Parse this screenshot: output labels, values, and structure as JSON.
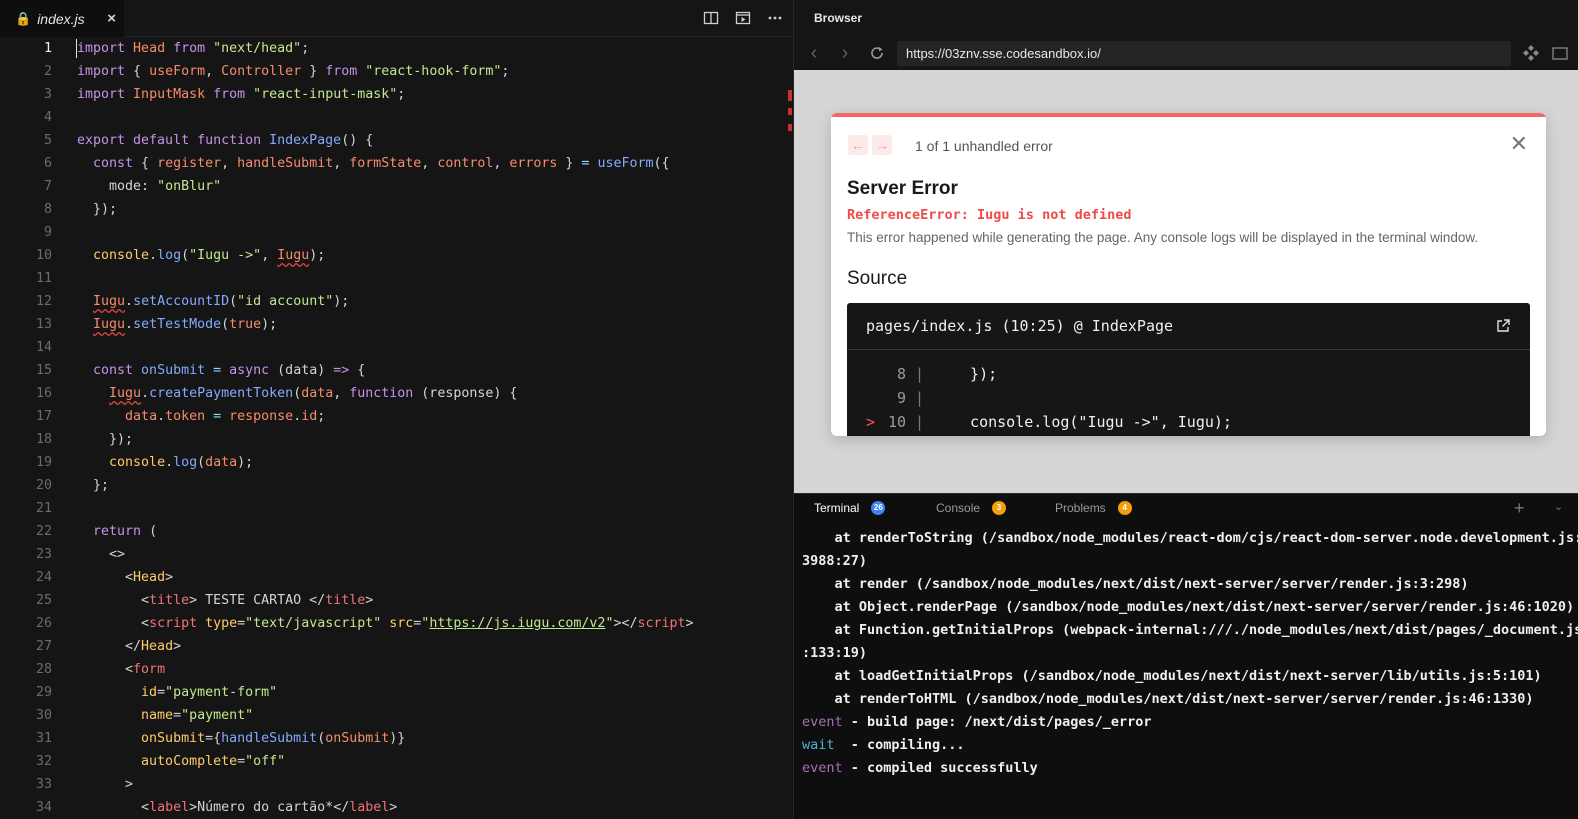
{
  "editor": {
    "tab": {
      "filename": "index.js",
      "close_glyph": "×"
    },
    "cursor_line": 1,
    "lines": [
      {
        "n": "1",
        "t": [
          [
            "kw",
            "import"
          ],
          [
            "var",
            " Head "
          ],
          [
            "kw",
            "from"
          ],
          [
            "str",
            " \"next/head\""
          ],
          [
            "dim",
            ";"
          ]
        ]
      },
      {
        "n": "2",
        "t": [
          [
            "kw",
            "import"
          ],
          [
            "dim",
            " { "
          ],
          [
            "var",
            "useForm"
          ],
          [
            "dim",
            ", "
          ],
          [
            "var",
            "Controller"
          ],
          [
            "dim",
            " } "
          ],
          [
            "kw",
            "from"
          ],
          [
            "str",
            " \"react-hook-form\""
          ],
          [
            "dim",
            ";"
          ]
        ]
      },
      {
        "n": "3",
        "t": [
          [
            "kw",
            "import"
          ],
          [
            "var",
            " InputMask "
          ],
          [
            "kw",
            "from"
          ],
          [
            "str",
            " \"react-input-mask\""
          ],
          [
            "dim",
            ";"
          ]
        ]
      },
      {
        "n": "4",
        "t": []
      },
      {
        "n": "5",
        "t": [
          [
            "kw",
            "export default function"
          ],
          [
            "fn",
            " IndexPage"
          ],
          [
            "dim",
            "() {"
          ]
        ]
      },
      {
        "n": "6",
        "t": [
          [
            "dim",
            "  "
          ],
          [
            "kw",
            "const"
          ],
          [
            "dim",
            " { "
          ],
          [
            "var",
            "register"
          ],
          [
            "dim",
            ", "
          ],
          [
            "var",
            "handleSubmit"
          ],
          [
            "dim",
            ", "
          ],
          [
            "var",
            "formState"
          ],
          [
            "dim",
            ", "
          ],
          [
            "var",
            "control"
          ],
          [
            "dim",
            ", "
          ],
          [
            "var",
            "errors"
          ],
          [
            "dim",
            " } "
          ],
          [
            "op",
            "="
          ],
          [
            "fn",
            " useForm"
          ],
          [
            "dim",
            "({"
          ]
        ]
      },
      {
        "n": "7",
        "t": [
          [
            "dim",
            "    mode: "
          ],
          [
            "str",
            "\"onBlur\""
          ]
        ]
      },
      {
        "n": "8",
        "t": [
          [
            "dim",
            "  });"
          ]
        ]
      },
      {
        "n": "9",
        "t": []
      },
      {
        "n": "10",
        "t": [
          [
            "dim",
            "  "
          ],
          [
            "yl",
            "console"
          ],
          [
            "dim",
            "."
          ],
          [
            "fn",
            "log"
          ],
          [
            "dim",
            "("
          ],
          [
            "str",
            "\"Iugu ->\""
          ],
          [
            "dim",
            ", "
          ],
          [
            "var err",
            "Iugu"
          ],
          [
            "dim",
            ");"
          ]
        ]
      },
      {
        "n": "11",
        "t": []
      },
      {
        "n": "12",
        "t": [
          [
            "dim",
            "  "
          ],
          [
            "var err",
            "Iugu"
          ],
          [
            "dim",
            "."
          ],
          [
            "fn",
            "setAccountID"
          ],
          [
            "dim",
            "("
          ],
          [
            "str",
            "\"id account\""
          ],
          [
            "dim",
            ");"
          ]
        ]
      },
      {
        "n": "13",
        "t": [
          [
            "dim",
            "  "
          ],
          [
            "var err",
            "Iugu"
          ],
          [
            "dim",
            "."
          ],
          [
            "fn",
            "setTestMode"
          ],
          [
            "dim",
            "("
          ],
          [
            "var",
            "true"
          ],
          [
            "dim",
            ");"
          ]
        ]
      },
      {
        "n": "14",
        "t": []
      },
      {
        "n": "15",
        "t": [
          [
            "dim",
            "  "
          ],
          [
            "kw",
            "const"
          ],
          [
            "fn",
            " onSubmit"
          ],
          [
            "op",
            " ="
          ],
          [
            "kw",
            " async"
          ],
          [
            "dim",
            " (data) "
          ],
          [
            "kw",
            "=>"
          ],
          [
            "dim",
            " {"
          ]
        ]
      },
      {
        "n": "16",
        "t": [
          [
            "dim",
            "    "
          ],
          [
            "var err",
            "Iugu"
          ],
          [
            "dim",
            "."
          ],
          [
            "fn",
            "createPaymentToken"
          ],
          [
            "dim",
            "("
          ],
          [
            "var",
            "data"
          ],
          [
            "dim",
            ", "
          ],
          [
            "kw",
            "function"
          ],
          [
            "dim",
            " (response) {"
          ]
        ]
      },
      {
        "n": "17",
        "t": [
          [
            "dim",
            "      "
          ],
          [
            "var",
            "data"
          ],
          [
            "dim",
            "."
          ],
          [
            "var",
            "token"
          ],
          [
            "op",
            " ="
          ],
          [
            "var",
            " response"
          ],
          [
            "dim",
            "."
          ],
          [
            "var",
            "id"
          ],
          [
            "dim",
            ";"
          ]
        ]
      },
      {
        "n": "18",
        "t": [
          [
            "dim",
            "    });"
          ]
        ]
      },
      {
        "n": "19",
        "t": [
          [
            "dim",
            "    "
          ],
          [
            "yl",
            "console"
          ],
          [
            "dim",
            "."
          ],
          [
            "fn",
            "log"
          ],
          [
            "dim",
            "("
          ],
          [
            "var",
            "data"
          ],
          [
            "dim",
            ");"
          ]
        ]
      },
      {
        "n": "20",
        "t": [
          [
            "dim",
            "  };"
          ]
        ]
      },
      {
        "n": "21",
        "t": []
      },
      {
        "n": "22",
        "t": [
          [
            "dim",
            "  "
          ],
          [
            "kw",
            "return"
          ],
          [
            "dim",
            " ("
          ]
        ]
      },
      {
        "n": "23",
        "t": [
          [
            "dim",
            "    <>"
          ]
        ]
      },
      {
        "n": "24",
        "t": [
          [
            "dim",
            "      <"
          ],
          [
            "yl",
            "Head"
          ],
          [
            "dim",
            ">"
          ]
        ]
      },
      {
        "n": "25",
        "t": [
          [
            "dim",
            "        <"
          ],
          [
            "tag",
            "title"
          ],
          [
            "dim",
            "> TESTE CARTAO </"
          ],
          [
            "tag",
            "title"
          ],
          [
            "dim",
            ">"
          ]
        ]
      },
      {
        "n": "26",
        "t": [
          [
            "dim",
            "        <"
          ],
          [
            "tag",
            "script"
          ],
          [
            "yl",
            " type"
          ],
          [
            "dim",
            "="
          ],
          [
            "str",
            "\"text/javascript\""
          ],
          [
            "yl",
            " src"
          ],
          [
            "dim",
            "="
          ],
          [
            "str",
            "\""
          ],
          [
            "str lnk",
            "https://js.iugu.com/v2"
          ],
          [
            "str",
            "\""
          ],
          [
            "dim",
            "></"
          ],
          [
            "tag",
            "script"
          ],
          [
            "dim",
            ">"
          ]
        ]
      },
      {
        "n": "27",
        "t": [
          [
            "dim",
            "      </"
          ],
          [
            "yl",
            "Head"
          ],
          [
            "dim",
            ">"
          ]
        ]
      },
      {
        "n": "28",
        "t": [
          [
            "dim",
            "      <"
          ],
          [
            "tag",
            "form"
          ]
        ]
      },
      {
        "n": "29",
        "t": [
          [
            "yl",
            "        id"
          ],
          [
            "dim",
            "="
          ],
          [
            "str",
            "\"payment-form\""
          ]
        ]
      },
      {
        "n": "30",
        "t": [
          [
            "yl",
            "        name"
          ],
          [
            "dim",
            "="
          ],
          [
            "str",
            "\"payment\""
          ]
        ]
      },
      {
        "n": "31",
        "t": [
          [
            "yl",
            "        onSubmit"
          ],
          [
            "dim",
            "={"
          ],
          [
            "fn",
            "handleSubmit"
          ],
          [
            "dim",
            "("
          ],
          [
            "var",
            "onSubmit"
          ],
          [
            "dim",
            ")}"
          ]
        ]
      },
      {
        "n": "32",
        "t": [
          [
            "yl",
            "        autoComplete"
          ],
          [
            "dim",
            "="
          ],
          [
            "str",
            "\"off\""
          ]
        ]
      },
      {
        "n": "33",
        "t": [
          [
            "dim",
            "      >"
          ]
        ]
      },
      {
        "n": "34",
        "t": [
          [
            "dim",
            "        <"
          ],
          [
            "tag",
            "label"
          ],
          [
            "dim",
            ">Número do cartão*</"
          ],
          [
            "tag",
            "label"
          ],
          [
            "dim",
            ">"
          ]
        ]
      }
    ]
  },
  "browser": {
    "title": "Browser",
    "url": "https://03znv.sse.codesandbox.io/",
    "error_overlay": {
      "count_text": "1 of 1 unhandled error",
      "title": "Server Error",
      "message": "ReferenceError: Iugu is not defined",
      "description": "This error happened while generating the page. Any console logs will be displayed in the terminal window.",
      "source_heading": "Source",
      "source_file": "pages/index.js (10:25) @ IndexPage",
      "source_lines": [
        {
          "arrow": "",
          "no": "8",
          "code": "  });"
        },
        {
          "arrow": "",
          "no": "9",
          "code": ""
        },
        {
          "arrow": ">",
          "no": "10",
          "code": "  console.log(\"Iugu ->\", Iugu);"
        }
      ]
    }
  },
  "terminal": {
    "tabs": [
      {
        "label": "Terminal",
        "badge": "26",
        "badge_color": "#3b82f6"
      },
      {
        "label": "Console",
        "badge": "3",
        "badge_color": "#f59e0b"
      },
      {
        "label": "Problems",
        "badge": "4",
        "badge_color": "#f59e0b"
      }
    ],
    "lines": [
      {
        "p": "",
        "text": "    at renderToString (/sandbox/node_modules/react-dom/cjs/react-dom-server.node.development.js:"
      },
      {
        "p": "",
        "text": "3988:27)"
      },
      {
        "p": "",
        "text": "    at render (/sandbox/node_modules/next/dist/next-server/server/render.js:3:298)"
      },
      {
        "p": "",
        "text": "    at Object.renderPage (/sandbox/node_modules/next/dist/next-server/server/render.js:46:1020)"
      },
      {
        "p": "",
        "text": "    at Function.getInitialProps (webpack-internal:///./node_modules/next/dist/pages/_document.js"
      },
      {
        "p": "",
        "text": ":133:19)"
      },
      {
        "p": "",
        "text": "    at loadGetInitialProps (/sandbox/node_modules/next/dist/next-server/lib/utils.js:5:101)"
      },
      {
        "p": "",
        "text": "    at renderToHTML (/sandbox/node_modules/next/dist/next-server/server/render.js:46:1330)"
      },
      {
        "p": "event",
        "text": " - build page: /next/dist/pages/_error"
      },
      {
        "p": "wait",
        "text": "  - compiling..."
      },
      {
        "p": "event",
        "text": " - compiled successfully"
      }
    ]
  }
}
